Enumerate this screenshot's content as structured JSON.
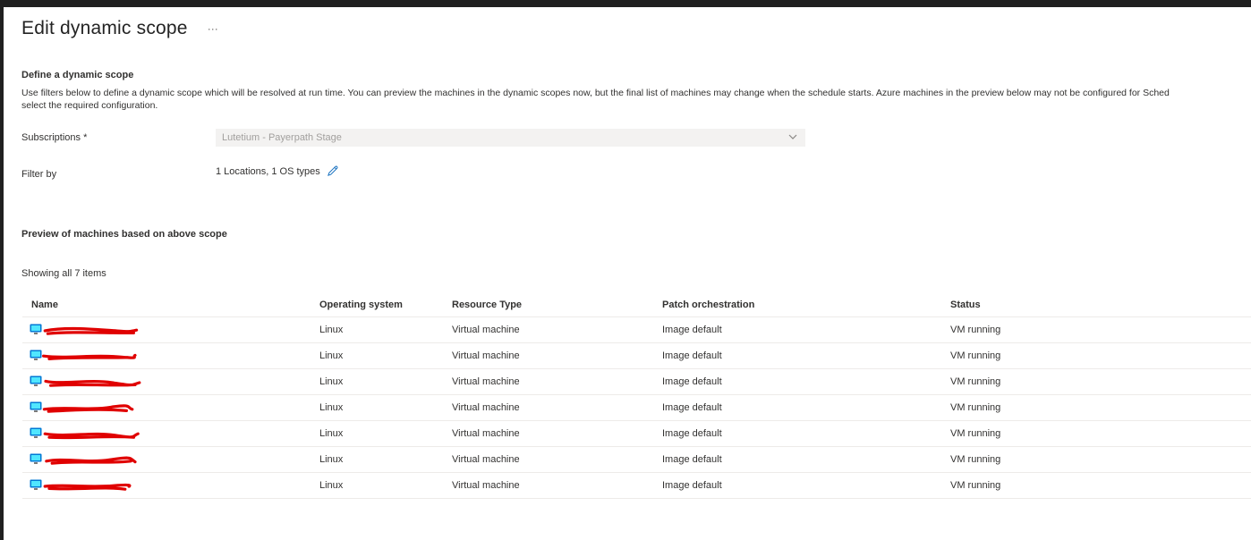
{
  "header": {
    "title": "Edit dynamic scope",
    "more_label": "···"
  },
  "define": {
    "heading": "Define a dynamic scope",
    "description_line1": "Use filters below to define a dynamic scope which will be resolved at run time. You can preview the machines in the dynamic scopes now, but the final list of machines may change when the schedule starts. Azure machines in the preview below may not be configured for Sched",
    "description_line2": "select the required configuration."
  },
  "form": {
    "subscriptions_label": "Subscriptions *",
    "subscriptions_value": "Lutetium - Payerpath Stage",
    "filter_label": "Filter by",
    "filter_value": "1 Locations, 1 OS types"
  },
  "preview": {
    "heading": "Preview of machines based on above scope",
    "count_text": "Showing all 7 items"
  },
  "table": {
    "headers": [
      "Name",
      "Operating system",
      "Resource Type",
      "Patch orchestration",
      "Status"
    ],
    "rows": [
      {
        "name": "",
        "os": "Linux",
        "type": "Virtual machine",
        "patch": "Image default",
        "status": "VM running"
      },
      {
        "name": "",
        "os": "Linux",
        "type": "Virtual machine",
        "patch": "Image default",
        "status": "VM running"
      },
      {
        "name": "",
        "os": "Linux",
        "type": "Virtual machine",
        "patch": "Image default",
        "status": "VM running"
      },
      {
        "name": "",
        "os": "Linux",
        "type": "Virtual machine",
        "patch": "Image default",
        "status": "VM running"
      },
      {
        "name": "",
        "os": "Linux",
        "type": "Virtual machine",
        "patch": "Image default",
        "status": "VM running"
      },
      {
        "name": "",
        "os": "Linux",
        "type": "Virtual machine",
        "patch": "Image default",
        "status": "VM running"
      },
      {
        "name": "",
        "os": "Linux",
        "type": "Virtual machine",
        "patch": "Image default",
        "status": "VM running"
      }
    ]
  },
  "icons": {
    "vm": "virtual-machine-icon",
    "edit": "pencil-icon",
    "dropdown": "chevron-down-icon"
  },
  "colors": {
    "link": "#0f6cbd",
    "redaction": "#e00000",
    "frame": "#202020"
  }
}
